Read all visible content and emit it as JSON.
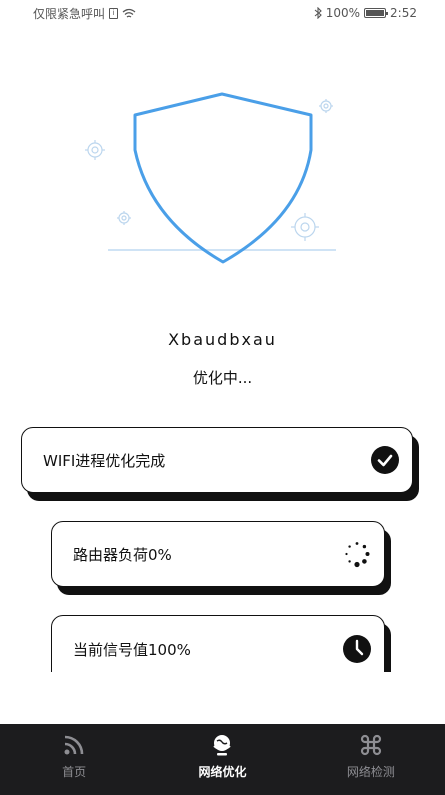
{
  "status_bar": {
    "carrier_text": "仅限紧急呼叫",
    "battery_percent": "100%",
    "time": "2:52"
  },
  "app": {
    "name": "Xbaudbxau",
    "status": "优化中..."
  },
  "items": [
    {
      "label": "WIFI进程优化完成",
      "icon": "check-circle-icon"
    },
    {
      "label": "路由器负荷0%",
      "icon": "loading-spinner-icon"
    },
    {
      "label": "当前信号值100%",
      "icon": "clock-icon"
    }
  ],
  "tabs": [
    {
      "label": "首页",
      "icon": "rss-signal-icon",
      "active": false
    },
    {
      "label": "网络优化",
      "icon": "globe-icon",
      "active": true
    },
    {
      "label": "网络检测",
      "icon": "command-icon",
      "active": false
    }
  ],
  "colors": {
    "shield_stroke": "#4a9fe8",
    "tab_bar_bg": "#1c1c1e",
    "card_border": "#111111"
  }
}
